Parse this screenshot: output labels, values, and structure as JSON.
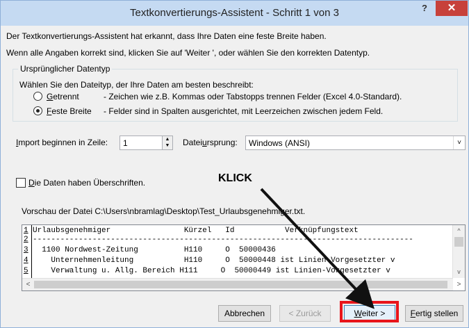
{
  "window": {
    "title": "Textkonvertierungs-Assistent - Schritt 1 von 3",
    "help": "?",
    "close": "✕"
  },
  "intro": {
    "line1": "Der Textkonvertierungs-Assistent hat erkannt, dass Ihre Daten eine feste Breite haben.",
    "line2": "Wenn alle Angaben korrekt sind, klicken Sie auf 'Weiter ', oder wählen Sie den korrekten Datentyp."
  },
  "datatype": {
    "legend": "Ursprünglicher Datentyp",
    "instruction": "Wählen Sie den Dateityp, der Ihre Daten am besten beschreibt:",
    "options": [
      {
        "accel": "G",
        "rest": "etrennt",
        "desc": "- Zeichen wie z.B. Kommas oder Tabstopps trennen Felder (Excel 4.0-Standard)."
      },
      {
        "accel": "F",
        "rest": "este Breite",
        "desc": "- Felder sind in Spalten ausgerichtet, mit Leerzeichen zwischen jedem Feld."
      }
    ]
  },
  "import": {
    "label_accel": "I",
    "label_rest": "mport beginnen in Zeile:",
    "start_row": "1",
    "origin_label_a": "Datei",
    "origin_label_accel": "u",
    "origin_label_b": "rsprung:",
    "origin_value": "Windows (ANSI)"
  },
  "headers_checkbox": {
    "accel": "D",
    "rest": "ie Daten haben Überschriften."
  },
  "annotation": {
    "text": "KLICK"
  },
  "preview": {
    "label": "Vorschau der Datei C:\\Users\\nbramlag\\Desktop\\Test_Urlaubsgenehmiger.txt.",
    "lines": [
      {
        "num": "1",
        "text": "Urlaubsgenehmiger                Kürzel   Id           Verknüpfungstext"
      },
      {
        "num": "2",
        "text": "-----------------------------------------------------------------------------------"
      },
      {
        "num": "3",
        "text": "  1100 Nordwest-Zeitung          H110     O  50000436"
      },
      {
        "num": "4",
        "text": "    Unternehmenleitung           H110     O  50000448 ist Linien-Vorgesetzter v"
      },
      {
        "num": "5",
        "text": "    Verwaltung u. Allg. Bereich H111     O  50000449 ist Linien-Vorgesetzter v"
      }
    ]
  },
  "buttons": {
    "cancel": "Abbrechen",
    "back": "< Zurück",
    "next_accel": "W",
    "next_rest": "eiter >",
    "finish_a": "F",
    "finish_rest": "ertig stellen"
  },
  "colors": {
    "titlebar": "#c5daf2",
    "close": "#c7413b",
    "highlight": "#e8151b"
  }
}
